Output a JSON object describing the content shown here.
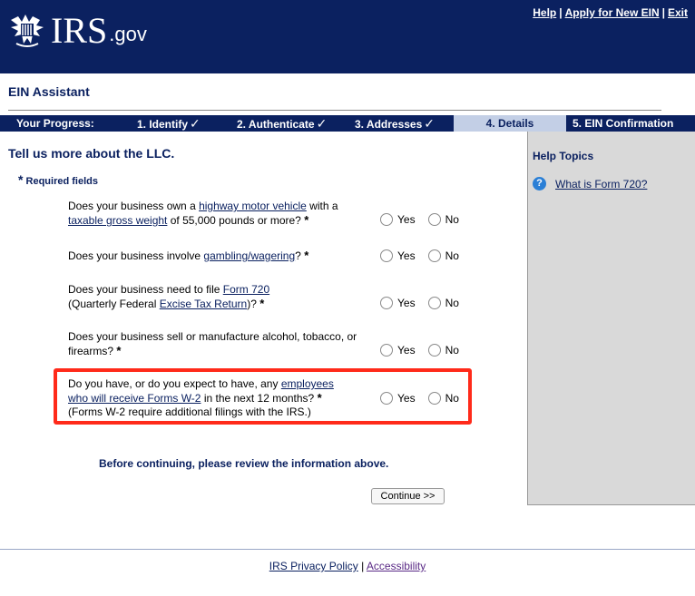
{
  "header": {
    "logo_irs": "IRS",
    "logo_gov": ".gov",
    "links": [
      "Help",
      "Apply for New EIN",
      "Exit"
    ],
    "separator": "|"
  },
  "app_title": "EIN Assistant",
  "progress": {
    "label": "Your Progress:",
    "steps": [
      {
        "label": "1. Identify",
        "complete": true
      },
      {
        "label": "2. Authenticate",
        "complete": true
      },
      {
        "label": "3. Addresses",
        "complete": true
      },
      {
        "label": "4. Details",
        "current": true
      },
      {
        "label": "5. EIN Confirmation"
      }
    ],
    "check": "✓",
    "colors": {
      "bar": "#0b2160",
      "current": "#c3cfe6"
    }
  },
  "form": {
    "heading": "Tell us more about the LLC.",
    "required_note": "Required fields",
    "asterisk": "*",
    "yes": "Yes",
    "no": "No",
    "questions": [
      {
        "parts": [
          "Does your business own a ",
          "highway motor vehicle",
          " with a ",
          "taxable gross weight",
          " of 55,000 pounds or more?"
        ]
      },
      {
        "parts": [
          "Does your business involve ",
          "gambling/wagering",
          "?"
        ]
      },
      {
        "parts": [
          "Does your business need to file ",
          "Form 720",
          "(Quarterly Federal ",
          "Excise Tax Return",
          ")?"
        ]
      },
      {
        "parts": [
          "Does your business sell or manufacture alcohol, tobacco, or firearms?"
        ]
      },
      {
        "parts": [
          "Do you have, or do you expect to have, any ",
          "employees who will receive Forms W-2",
          " in the next 12 months?",
          "(Forms W-2 require additional filings with the IRS.)"
        ],
        "highlighted": true
      }
    ],
    "review_note": "Before continuing, please review the information above.",
    "continue_label": "Continue >>"
  },
  "help": {
    "title": "Help Topics",
    "items": [
      "What is Form 720?"
    ]
  },
  "footer": {
    "privacy": "IRS Privacy Policy",
    "separator": "|",
    "accessibility": "Accessibility"
  },
  "colors": {
    "navy": "#0b2160",
    "highlight": "#ff2a1a",
    "help_panel": "#d9d9d9"
  }
}
